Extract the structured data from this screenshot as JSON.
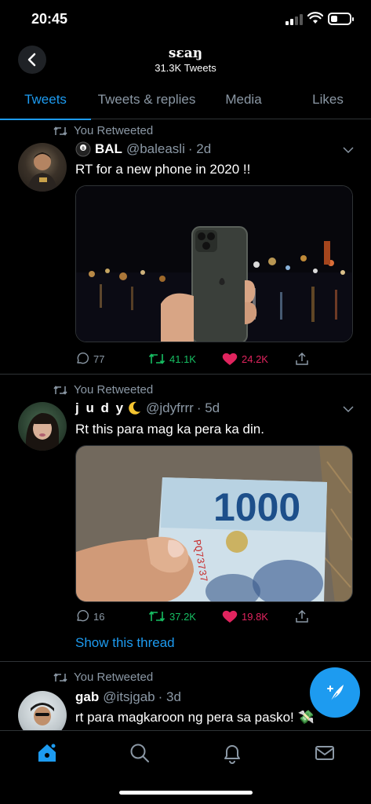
{
  "status_bar": {
    "time": "20:45"
  },
  "header": {
    "title": "sɛaŋ",
    "subtitle": "31.3K Tweets"
  },
  "tabs": [
    {
      "label": "Tweets",
      "active": true
    },
    {
      "label": "Tweets & replies",
      "active": false
    },
    {
      "label": "Media",
      "active": false
    },
    {
      "label": "Likes",
      "active": false
    }
  ],
  "tweets": [
    {
      "retweet_label": "You Retweeted",
      "name": "BAL",
      "handle": "@baleasli",
      "time": "· 2d",
      "text": "RT for a new phone in 2020 !!",
      "media": "phone-photo",
      "replies": "77",
      "retweets": "41.1K",
      "likes": "24.2K"
    },
    {
      "retweet_label": "You Retweeted",
      "name": "j u d y",
      "handle": "@jdyfrrr",
      "time": "· 5d",
      "text": "Rt this para mag ka pera ka din.",
      "media": "banknote-photo",
      "media_text": "1000",
      "serial": "PQ73737",
      "replies": "16",
      "retweets": "37.2K",
      "likes": "19.8K",
      "thread_link": "Show this thread"
    },
    {
      "retweet_label": "You Retweeted",
      "name": "gab",
      "handle": "@itsjgab",
      "time": "· 3d",
      "text": "rt para magkaroon ng pera sa pasko! 💸"
    }
  ],
  "colors": {
    "accent": "#1d9bf0",
    "retweet": "#17bf63",
    "like": "#e0245e",
    "muted": "#8b98a5"
  }
}
